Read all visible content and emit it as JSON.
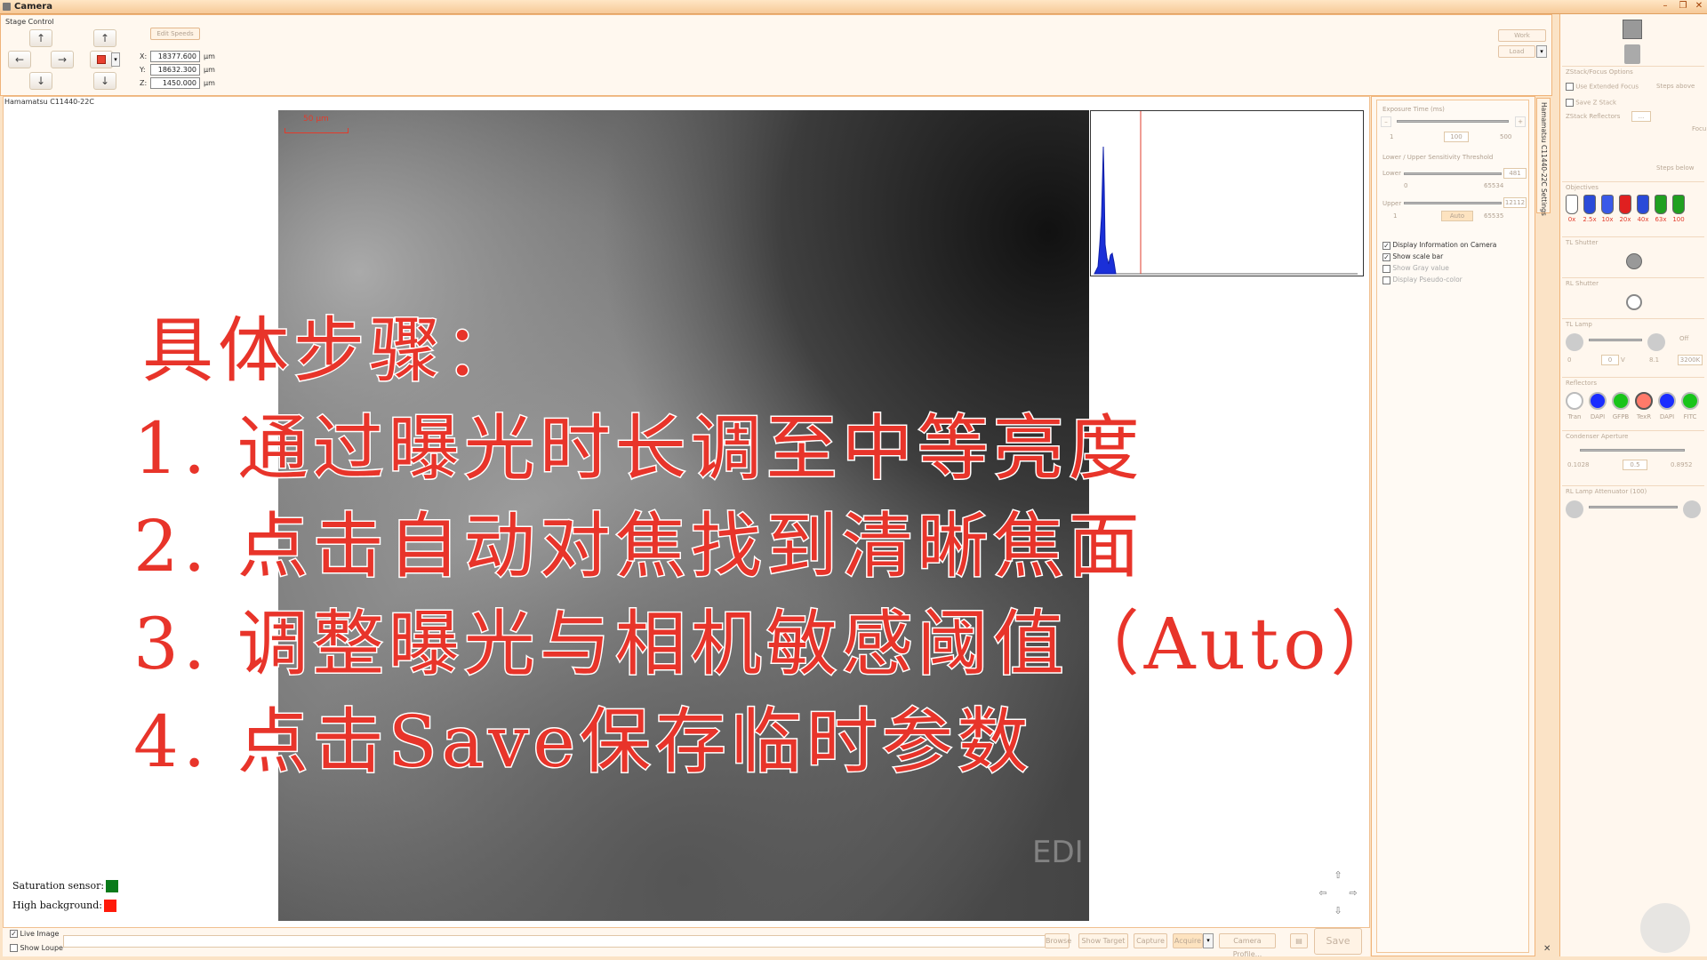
{
  "window": {
    "title": "Camera",
    "controls": [
      "–",
      "❐",
      "✕"
    ]
  },
  "stage_control": {
    "label": "Stage Control",
    "edit_speeds": "Edit Speeds",
    "coords": [
      {
        "axis": "X:",
        "value": "18377.600",
        "unit": "µm"
      },
      {
        "axis": "Y:",
        "value": "18632.300",
        "unit": "µm"
      },
      {
        "axis": "Z:",
        "value": "1450.000",
        "unit": "µm"
      }
    ],
    "work_label": "Work",
    "load_label": "Load"
  },
  "camera": {
    "name": "Hamamatsu C11440-22C",
    "scale_bar": "50 µm",
    "watermark": "EDI",
    "saturation_label": "Saturation sensor:",
    "saturation_color": "#0a7a1a",
    "highbg_label": "High background:",
    "highbg_color": "#ff1a0a"
  },
  "bottom": {
    "live_image": "Live Image",
    "show_loupe": "Show Loupe",
    "browse": "Browse",
    "show_target": "Show Target",
    "capture": "Capture",
    "acquire": "Acquire",
    "camera_profile": "Camera Profile...",
    "save": "Save"
  },
  "settings": {
    "tab": "Hamamatsu C11440-22C Settings",
    "exposure_title": "Exposure Time (ms)",
    "exposure_min": "1",
    "exposure_value": "100",
    "exposure_max": "500",
    "threshold_title": "Lower / Upper Sensitivity Threshold",
    "lower_label": "Lower",
    "lower_value": "481",
    "lower_min": "0",
    "lower_max": "65534",
    "upper_label": "Upper",
    "upper_value": "12112",
    "upper_min": "1",
    "upper_max": "65535",
    "auto": "Auto",
    "opt_info": "Display Information on Camera",
    "opt_scale": "Show scale bar",
    "opt_gray": "Show Gray value",
    "opt_pseudo": "Display Pseudo-color"
  },
  "right_panel": {
    "zstack_title": "ZStack/Focus Options",
    "use_ext_focus": "Use Extended Focus",
    "steps_above": "Steps above",
    "save_zstack": "Save Z Stack",
    "zstack_reflectors": "ZStack Reflectors",
    "focus": "Focu",
    "steps_below": "Steps below",
    "objectives_title": "Objectives",
    "objectives": [
      "0x",
      "2.5x",
      "10x",
      "20x",
      "40x",
      "63x",
      "100"
    ],
    "tl_shutter": "TL Shutter",
    "rl_shutter": "RL Shutter",
    "tl_lamp": "TL Lamp",
    "tl_lamp_off": "Off",
    "tl_lamp_min": "0",
    "tl_lamp_value": "0",
    "tl_lamp_unit": "V",
    "tl_lamp_max": "8.1",
    "tl_lamp_temp": "3200K",
    "reflectors_title": "Reflectors",
    "reflectors": [
      {
        "label": "Tran",
        "color": "#ffffff"
      },
      {
        "label": "DAPI",
        "color": "#1a2cff"
      },
      {
        "label": "GFPB",
        "color": "#19c419"
      },
      {
        "label": "TexR",
        "color": "#ff7a6a"
      },
      {
        "label": "DAPI",
        "color": "#1a2cff"
      },
      {
        "label": "FITC",
        "color": "#19c419"
      }
    ],
    "condenser_title": "Condenser Aperture",
    "condenser_min": "0.1028",
    "condenser_value": "0.5",
    "condenser_max": "0.8952",
    "rl_att_title": "RL Lamp Attenuator (100)"
  },
  "overlay": {
    "heading": "具体步骤：",
    "steps": [
      "1. 通过曝光时长调至中等亮度",
      "2. 点击自动对焦找到清晰焦面",
      "3. 调整曝光与相机敏感阈值（Auto）",
      "4. 点击Save保存临时参数"
    ]
  }
}
